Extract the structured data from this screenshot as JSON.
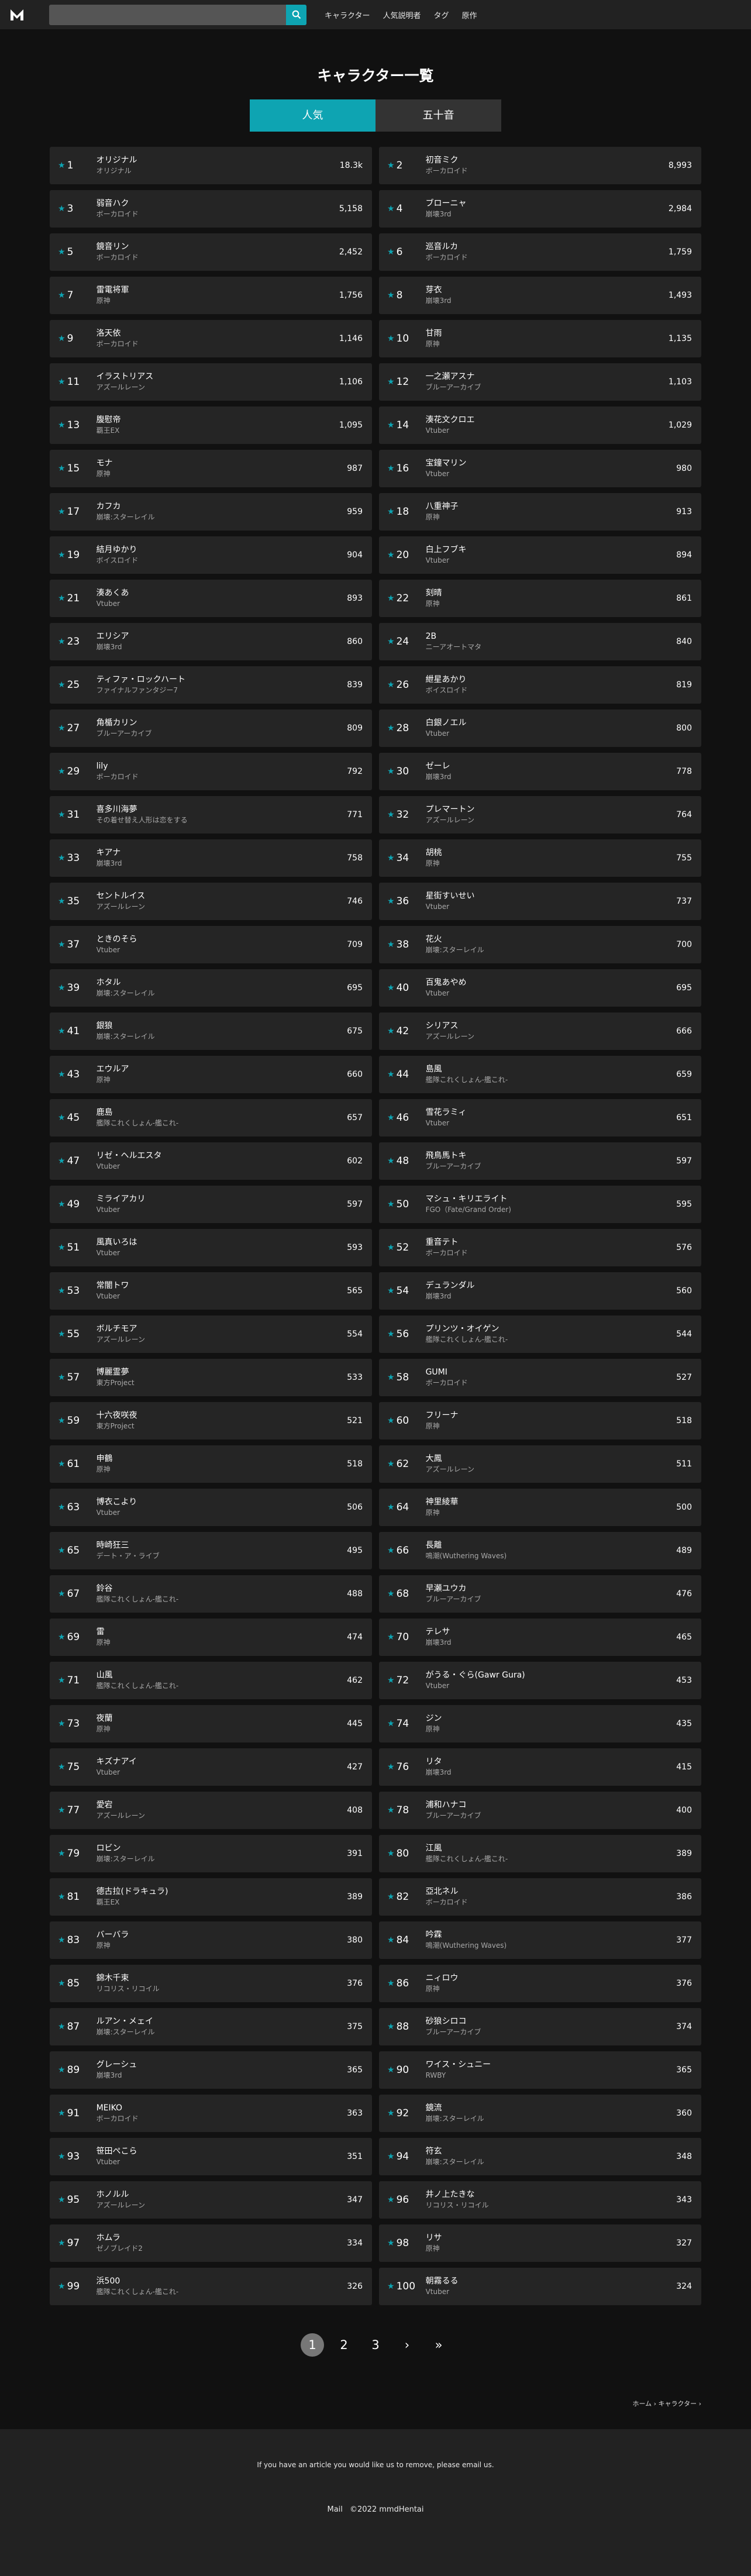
{
  "header": {
    "logo_alt": "M",
    "search_placeholder": "",
    "nav": [
      "キャラクター",
      "人気説明者",
      "タグ",
      "原作"
    ]
  },
  "page_title": "キャラクター一覧",
  "tabs": [
    {
      "label": "人気",
      "active": true
    },
    {
      "label": "五十音",
      "active": false
    }
  ],
  "characters": [
    {
      "rank": "1",
      "name": "オリジナル",
      "series": "オリジナル",
      "count": "18.3k"
    },
    {
      "rank": "2",
      "name": "初音ミク",
      "series": "ボーカロイド",
      "count": "8,993"
    },
    {
      "rank": "3",
      "name": "弱音ハク",
      "series": "ボーカロイド",
      "count": "5,158"
    },
    {
      "rank": "4",
      "name": "ブローニャ",
      "series": "崩壊3rd",
      "count": "2,984"
    },
    {
      "rank": "5",
      "name": "鏡音リン",
      "series": "ボーカロイド",
      "count": "2,452"
    },
    {
      "rank": "6",
      "name": "巡音ルカ",
      "series": "ボーカロイド",
      "count": "1,759"
    },
    {
      "rank": "7",
      "name": "雷電将軍",
      "series": "原神",
      "count": "1,756"
    },
    {
      "rank": "8",
      "name": "芽衣",
      "series": "崩壊3rd",
      "count": "1,493"
    },
    {
      "rank": "9",
      "name": "洛天依",
      "series": "ボーカロイド",
      "count": "1,146"
    },
    {
      "rank": "10",
      "name": "甘雨",
      "series": "原神",
      "count": "1,135"
    },
    {
      "rank": "11",
      "name": "イラストリアス",
      "series": "アズールレーン",
      "count": "1,106"
    },
    {
      "rank": "12",
      "name": "一之瀬アスナ",
      "series": "ブルーアーカイブ",
      "count": "1,103"
    },
    {
      "rank": "13",
      "name": "腹慰帝",
      "series": "覇王EX",
      "count": "1,095"
    },
    {
      "rank": "14",
      "name": "湊花文クロエ",
      "series": "Vtuber",
      "count": "1,029"
    },
    {
      "rank": "15",
      "name": "モナ",
      "series": "原神",
      "count": "987"
    },
    {
      "rank": "16",
      "name": "宝鐘マリン",
      "series": "Vtuber",
      "count": "980"
    },
    {
      "rank": "17",
      "name": "カフカ",
      "series": "崩壊:スターレイル",
      "count": "959"
    },
    {
      "rank": "18",
      "name": "八重神子",
      "series": "原神",
      "count": "913"
    },
    {
      "rank": "19",
      "name": "結月ゆかり",
      "series": "ボイスロイド",
      "count": "904"
    },
    {
      "rank": "20",
      "name": "白上フブキ",
      "series": "Vtuber",
      "count": "894"
    },
    {
      "rank": "21",
      "name": "湊あくあ",
      "series": "Vtuber",
      "count": "893"
    },
    {
      "rank": "22",
      "name": "刻晴",
      "series": "原神",
      "count": "861"
    },
    {
      "rank": "23",
      "name": "エリシア",
      "series": "崩壊3rd",
      "count": "860"
    },
    {
      "rank": "24",
      "name": "2B",
      "series": "ニーアオートマタ",
      "count": "840"
    },
    {
      "rank": "25",
      "name": "ティファ・ロックハート",
      "series": "ファイナルファンタジー7",
      "count": "839"
    },
    {
      "rank": "26",
      "name": "紲星あかり",
      "series": "ボイスロイド",
      "count": "819"
    },
    {
      "rank": "27",
      "name": "角楯カリン",
      "series": "ブルーアーカイブ",
      "count": "809"
    },
    {
      "rank": "28",
      "name": "白銀ノエル",
      "series": "Vtuber",
      "count": "800"
    },
    {
      "rank": "29",
      "name": "lily",
      "series": "ボーカロイド",
      "count": "792"
    },
    {
      "rank": "30",
      "name": "ゼーレ",
      "series": "崩壊3rd",
      "count": "778"
    },
    {
      "rank": "31",
      "name": "喜多川海夢",
      "series": "その着せ替え人形は恋をする",
      "count": "771"
    },
    {
      "rank": "32",
      "name": "プレマートン",
      "series": "アズールレーン",
      "count": "764"
    },
    {
      "rank": "33",
      "name": "キアナ",
      "series": "崩壊3rd",
      "count": "758"
    },
    {
      "rank": "34",
      "name": "胡桃",
      "series": "原神",
      "count": "755"
    },
    {
      "rank": "35",
      "name": "セントルイス",
      "series": "アズールレーン",
      "count": "746"
    },
    {
      "rank": "36",
      "name": "星街すいせい",
      "series": "Vtuber",
      "count": "737"
    },
    {
      "rank": "37",
      "name": "ときのそら",
      "series": "Vtuber",
      "count": "709"
    },
    {
      "rank": "38",
      "name": "花火",
      "series": "崩壊:スターレイル",
      "count": "700"
    },
    {
      "rank": "39",
      "name": "ホタル",
      "series": "崩壊:スターレイル",
      "count": "695"
    },
    {
      "rank": "40",
      "name": "百鬼あやめ",
      "series": "Vtuber",
      "count": "695"
    },
    {
      "rank": "41",
      "name": "銀狼",
      "series": "崩壊:スターレイル",
      "count": "675"
    },
    {
      "rank": "42",
      "name": "シリアス",
      "series": "アズールレーン",
      "count": "666"
    },
    {
      "rank": "43",
      "name": "エウルア",
      "series": "原神",
      "count": "660"
    },
    {
      "rank": "44",
      "name": "島風",
      "series": "艦隊これくしょん-艦これ-",
      "count": "659"
    },
    {
      "rank": "45",
      "name": "鹿島",
      "series": "艦隊これくしょん-艦これ-",
      "count": "657"
    },
    {
      "rank": "46",
      "name": "雪花ラミィ",
      "series": "Vtuber",
      "count": "651"
    },
    {
      "rank": "47",
      "name": "リゼ・ヘルエスタ",
      "series": "Vtuber",
      "count": "602"
    },
    {
      "rank": "48",
      "name": "飛鳥馬トキ",
      "series": "ブルーアーカイブ",
      "count": "597"
    },
    {
      "rank": "49",
      "name": "ミライアカリ",
      "series": "Vtuber",
      "count": "597"
    },
    {
      "rank": "50",
      "name": "マシュ・キリエライト",
      "series": "FGO（Fate/Grand Order)",
      "count": "595"
    },
    {
      "rank": "51",
      "name": "風真いろは",
      "series": "Vtuber",
      "count": "593"
    },
    {
      "rank": "52",
      "name": "重音テト",
      "series": "ボーカロイド",
      "count": "576"
    },
    {
      "rank": "53",
      "name": "常闇トワ",
      "series": "Vtuber",
      "count": "565"
    },
    {
      "rank": "54",
      "name": "デュランダル",
      "series": "崩壊3rd",
      "count": "560"
    },
    {
      "rank": "55",
      "name": "ボルチモア",
      "series": "アズールレーン",
      "count": "554"
    },
    {
      "rank": "56",
      "name": "プリンツ・オイゲン",
      "series": "艦隊これくしょん-艦これ-",
      "count": "544"
    },
    {
      "rank": "57",
      "name": "博麗霊夢",
      "series": "東方Project",
      "count": "533"
    },
    {
      "rank": "58",
      "name": "GUMI",
      "series": "ボーカロイド",
      "count": "527"
    },
    {
      "rank": "59",
      "name": "十六夜咲夜",
      "series": "東方Project",
      "count": "521"
    },
    {
      "rank": "60",
      "name": "フリーナ",
      "series": "原神",
      "count": "518"
    },
    {
      "rank": "61",
      "name": "申鶴",
      "series": "原神",
      "count": "518"
    },
    {
      "rank": "62",
      "name": "大鳳",
      "series": "アズールレーン",
      "count": "511"
    },
    {
      "rank": "63",
      "name": "博衣こより",
      "series": "Vtuber",
      "count": "506"
    },
    {
      "rank": "64",
      "name": "神里綾華",
      "series": "原神",
      "count": "500"
    },
    {
      "rank": "65",
      "name": "時崎狂三",
      "series": "デート・ア・ライブ",
      "count": "495"
    },
    {
      "rank": "66",
      "name": "長離",
      "series": "鳴潮(Wuthering Waves)",
      "count": "489"
    },
    {
      "rank": "67",
      "name": "鈴谷",
      "series": "艦隊これくしょん-艦これ-",
      "count": "488"
    },
    {
      "rank": "68",
      "name": "早瀬ユウカ",
      "series": "ブルーアーカイブ",
      "count": "476"
    },
    {
      "rank": "69",
      "name": "雷",
      "series": "原神",
      "count": "474"
    },
    {
      "rank": "70",
      "name": "テレサ",
      "series": "崩壊3rd",
      "count": "465"
    },
    {
      "rank": "71",
      "name": "山風",
      "series": "艦隊これくしょん-艦これ-",
      "count": "462"
    },
    {
      "rank": "72",
      "name": "がうる・ぐら(Gawr Gura)",
      "series": "Vtuber",
      "count": "453"
    },
    {
      "rank": "73",
      "name": "夜蘭",
      "series": "原神",
      "count": "445"
    },
    {
      "rank": "74",
      "name": "ジン",
      "series": "原神",
      "count": "435"
    },
    {
      "rank": "75",
      "name": "キズナアイ",
      "series": "Vtuber",
      "count": "427"
    },
    {
      "rank": "76",
      "name": "リタ",
      "series": "崩壊3rd",
      "count": "415"
    },
    {
      "rank": "77",
      "name": "愛宕",
      "series": "アズールレーン",
      "count": "408"
    },
    {
      "rank": "78",
      "name": "浦和ハナコ",
      "series": "ブルーアーカイブ",
      "count": "400"
    },
    {
      "rank": "79",
      "name": "ロビン",
      "series": "崩壊:スターレイル",
      "count": "391"
    },
    {
      "rank": "80",
      "name": "江風",
      "series": "艦隊これくしょん-艦これ-",
      "count": "389"
    },
    {
      "rank": "81",
      "name": "德古拉(ドラキュラ)",
      "series": "覇王EX",
      "count": "389"
    },
    {
      "rank": "82",
      "name": "亞北ネル",
      "series": "ボーカロイド",
      "count": "386"
    },
    {
      "rank": "83",
      "name": "バーバラ",
      "series": "原神",
      "count": "380"
    },
    {
      "rank": "84",
      "name": "吟霖",
      "series": "鳴潮(Wuthering Waves)",
      "count": "377"
    },
    {
      "rank": "85",
      "name": "錦木千束",
      "series": "リコリス・リコイル",
      "count": "376"
    },
    {
      "rank": "86",
      "name": "ニィロウ",
      "series": "原神",
      "count": "376"
    },
    {
      "rank": "87",
      "name": "ルアン・メェイ",
      "series": "崩壊:スターレイル",
      "count": "375"
    },
    {
      "rank": "88",
      "name": "砂狼シロコ",
      "series": "ブルーアーカイブ",
      "count": "374"
    },
    {
      "rank": "89",
      "name": "グレーシュ",
      "series": "崩壊3rd",
      "count": "365"
    },
    {
      "rank": "90",
      "name": "ワイス・シュニー",
      "series": "RWBY",
      "count": "365"
    },
    {
      "rank": "91",
      "name": "MEIKO",
      "series": "ボーカロイド",
      "count": "363"
    },
    {
      "rank": "92",
      "name": "鏡流",
      "series": "崩壊:スターレイル",
      "count": "360"
    },
    {
      "rank": "93",
      "name": "笹田ぺこら",
      "series": "Vtuber",
      "count": "351"
    },
    {
      "rank": "94",
      "name": "符玄",
      "series": "崩壊:スターレイル",
      "count": "348"
    },
    {
      "rank": "95",
      "name": "ホノルル",
      "series": "アズールレーン",
      "count": "347"
    },
    {
      "rank": "96",
      "name": "井ノ上たきな",
      "series": "リコリス・リコイル",
      "count": "343"
    },
    {
      "rank": "97",
      "name": "ホムラ",
      "series": "ゼノブレイド2",
      "count": "334"
    },
    {
      "rank": "98",
      "name": "リサ",
      "series": "原神",
      "count": "327"
    },
    {
      "rank": "99",
      "name": "浜500",
      "series": "艦隊これくしょん-艦これ-",
      "count": "326"
    },
    {
      "rank": "100",
      "name": "朝霧るる",
      "series": "Vtuber",
      "count": "324"
    }
  ],
  "pagination": {
    "pages": [
      "1",
      "2",
      "3"
    ],
    "current": "1",
    "next": "›",
    "last": "»"
  },
  "breadcrumb": "ホーム › キャラクター ›",
  "footer": {
    "notice": "If you have an article you would like us to remove, please email us.",
    "mail_label": "Mail",
    "copyright": "©2022 mmdHentai"
  },
  "colors": {
    "accent": "#0ea4b2",
    "background": "#111111",
    "card": "#252525",
    "nav": "#222222"
  }
}
